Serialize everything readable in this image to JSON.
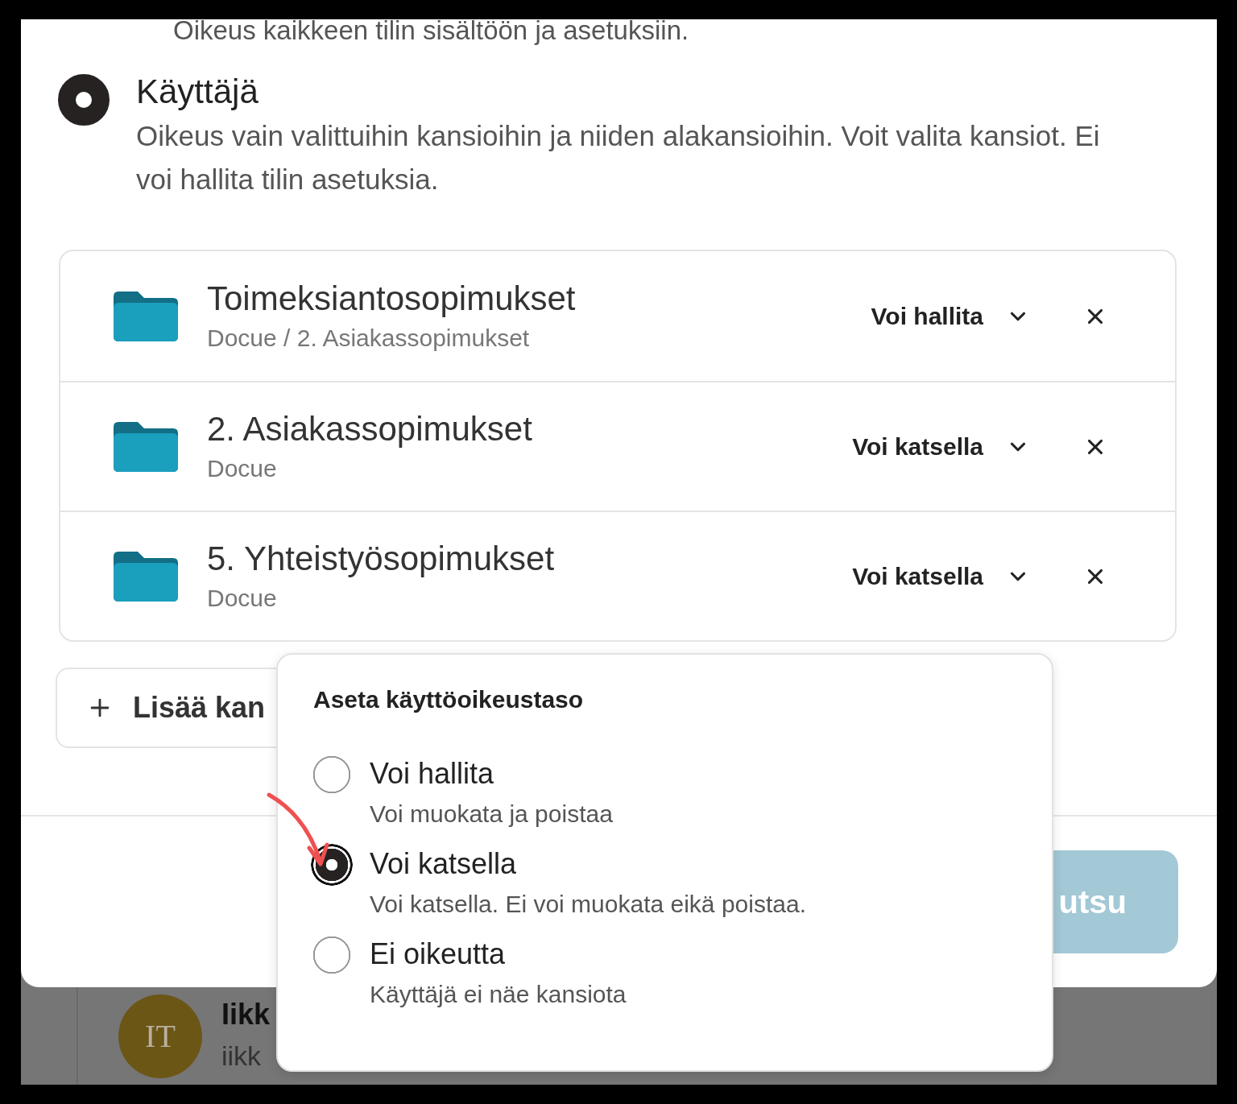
{
  "previous_option": {
    "description": "Oikeus kaikkeen tilin sisältöön ja asetuksiin."
  },
  "user_option": {
    "title": "Käyttäjä",
    "description": "Oikeus vain valittuihin kansioihin ja niiden alakansioihin. Voit valita kansiot. Ei voi hallita tilin asetuksia.",
    "selected": true
  },
  "folders": [
    {
      "name": "Toimeksiantosopimukset",
      "path": "Docue / 2. Asiakassopimukset",
      "permission": "Voi hallita"
    },
    {
      "name": "2. Asiakassopimukset",
      "path": "Docue",
      "permission": "Voi katsella"
    },
    {
      "name": "5. Yhteistyösopimukset",
      "path": "Docue",
      "permission": "Voi katsella"
    }
  ],
  "add_folder_button": {
    "label": "Lisää kan"
  },
  "footer": {
    "primary_button": "utsu"
  },
  "background_contact": {
    "initials": "IT",
    "name": "Iikk",
    "email": "iikk"
  },
  "permission_menu": {
    "title": "Aseta käyttöoikeustaso",
    "options": [
      {
        "title": "Voi hallita",
        "description": "Voi muokata ja poistaa",
        "selected": false
      },
      {
        "title": "Voi katsella",
        "description": "Voi katsella. Ei voi muokata eikä poistaa.",
        "selected": true
      },
      {
        "title": "Ei oikeutta",
        "description": "Käyttäjä ei näe kansiota",
        "selected": false
      }
    ]
  }
}
